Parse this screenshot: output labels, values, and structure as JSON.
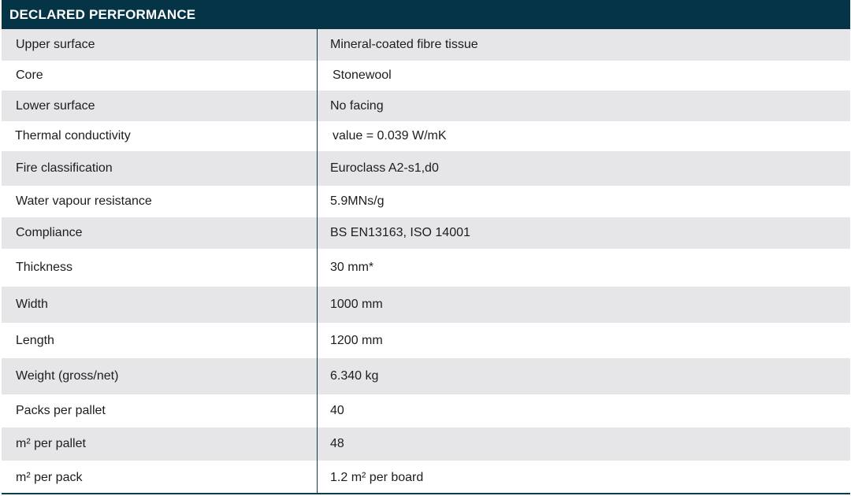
{
  "header": {
    "title": "DECLARED PERFORMANCE"
  },
  "rows": [
    {
      "label": "Upper surface",
      "value": "Mineral-coated fibre tissue"
    },
    {
      "label": "Core",
      "value": "Stonewool"
    },
    {
      "label": "Lower surface",
      "value": "No facing"
    },
    {
      "label": "Thermal conductivity",
      "value": "value = 0.039 W/mK"
    },
    {
      "label": "Fire classification",
      "value": "Euroclass A2-s1,d0"
    },
    {
      "label": "Water vapour resistance",
      "value": "5.9MNs/g"
    },
    {
      "label": "Compliance",
      "value": "BS EN13163, ISO 14001"
    },
    {
      "label": "Thickness",
      "value": "30 mm*"
    },
    {
      "label": "Width",
      "value": "1000 mm"
    },
    {
      "label": "Length",
      "value": "1200 mm"
    },
    {
      "label": "Weight (gross/net)",
      "value": "6.340 kg"
    },
    {
      "label": "Packs per pallet",
      "value": "40"
    },
    {
      "label": "m² per pallet",
      "value": "48"
    },
    {
      "label": "m² per pack",
      "value": "1.2 m² per board"
    }
  ]
}
